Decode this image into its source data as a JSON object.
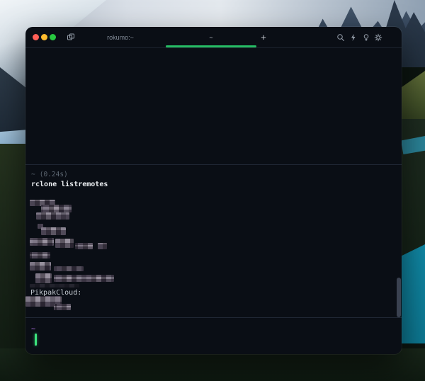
{
  "titlebar": {
    "tab_inactive_title": "rokumo:~",
    "tab_active_title": "~",
    "new_tab_label": "+"
  },
  "terminal": {
    "finished_block": {
      "cwd": "~",
      "duration": "(0.24s)",
      "command": "rclone listremotes"
    },
    "output": {
      "visible_remote": "PikpakCloud:",
      "redacted_line_count": 7
    },
    "active_prompt": {
      "cwd": "~"
    }
  },
  "colors": {
    "terminal_bg": "#0a0e15",
    "accent_tab_green": "#26bd64",
    "cursor_green": "#3ce37d",
    "prompt_purple": "#8a5ab5",
    "traffic_close_red": "#ff5f57",
    "traffic_minimize_yellow": "#febc2e",
    "traffic_zoom_green": "#28c840"
  }
}
